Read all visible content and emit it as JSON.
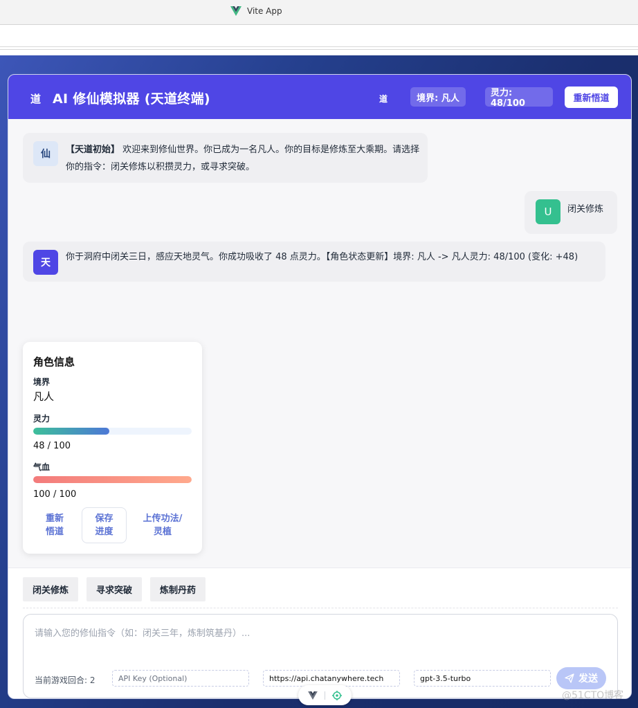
{
  "browser": {
    "tab_title": "Vite App"
  },
  "header": {
    "logo": "道",
    "title": "AI 修仙模拟器 (天道终端)",
    "dao": "道",
    "realm_pill": "境界: 凡人",
    "spirit_pill": "灵力: 48/100",
    "restart_label": "重新悟道"
  },
  "messages": [
    {
      "avatar": "仙",
      "tag": "【天道初始】",
      "text": " 欢迎来到修仙世界。你已成为一名凡人。你的目标是修炼至大乘期。请选择你的指令：闭关修炼以积攒灵力，或寻求突破。"
    },
    {
      "avatar": "U",
      "text": "闭关修炼"
    },
    {
      "avatar": "天",
      "text": "你于洞府中闭关三日，感应天地灵气。你成功吸收了 48 点灵力。【角色状态更新】境界: 凡人 -> 凡人灵力: 48/100 (变化: +48)"
    }
  ],
  "character": {
    "title": "角色信息",
    "realm_label": "境界",
    "realm_value": "凡人",
    "spirit_label": "灵力",
    "spirit_text": "48 / 100",
    "spirit_fraction": 0.48,
    "blood_label": "气血",
    "blood_text": "100 / 100",
    "blood_fraction": 1.0,
    "btn_restart": "重新\n悟道",
    "btn_save": "保存\n进度",
    "btn_upload": "上传功法/\n灵植"
  },
  "quick_actions": [
    "闭关修炼",
    "寻求突破",
    "炼制丹药"
  ],
  "input": {
    "placeholder": "请输入您的修仙指令（如：闭关三年，炼制筑基丹）...",
    "round_label": "当前游戏回合: 2",
    "api_key_placeholder": "API Key (Optional)",
    "api_url": "https://api.chatanywhere.tech",
    "model": "gpt-3.5-turbo",
    "send_label": "发送"
  },
  "watermark": "@51CTO博客",
  "colors": {
    "accent": "#4f46e5",
    "user_avatar": "#34c08f"
  }
}
